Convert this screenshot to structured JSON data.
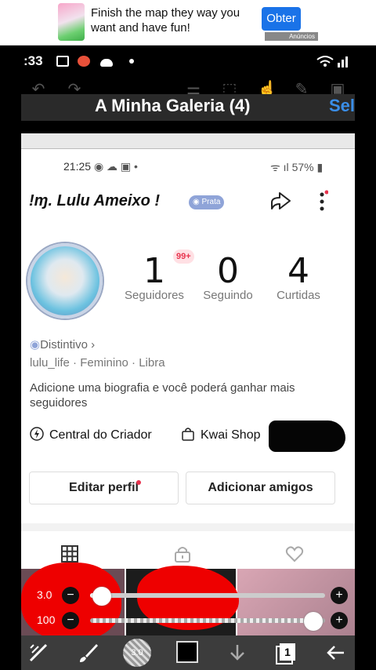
{
  "ad": {
    "text": "Finish the map they way you want and have fun!",
    "button": "Obter",
    "tag": "Anúncios"
  },
  "outer": {
    "time": ":33",
    "gallery_title": "A Minha Galeria (4)",
    "select_label": "Sel"
  },
  "inner_status": {
    "time": "21:25",
    "battery": "57%"
  },
  "profile": {
    "name": "!ɱ. Lulu Ameixo !",
    "badge": "Prata",
    "notif_count": "99+",
    "stats": [
      {
        "value": "1",
        "label": "Seguidores"
      },
      {
        "value": "0",
        "label": "Seguindo"
      },
      {
        "value": "4",
        "label": "Curtidas"
      }
    ],
    "distintivo": "Distintivo ›",
    "meta": "lulu_life · Feminino · Libra",
    "bio": "Adicione uma biografia e você poderá ganhar mais seguidores",
    "creator_center": "Central do Criador",
    "kwai_shop": "Kwai Shop",
    "edit_profile": "Editar perfil",
    "add_friends": "Adicionar amigos"
  },
  "sliders": [
    {
      "label": "3.0",
      "value": 0.05
    },
    {
      "label": "100",
      "value": 0.95
    }
  ],
  "bottombar": {
    "brush_size": "3.0",
    "layer_number": "1",
    "primary_color": "#000000"
  },
  "colors": {
    "accent": "#1a73e8",
    "red": "#e00000"
  }
}
